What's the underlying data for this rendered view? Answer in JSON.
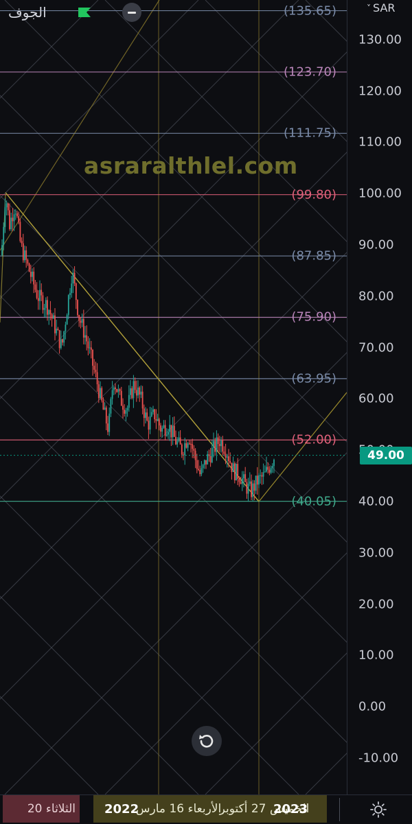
{
  "header": {
    "symbol": "الجوف",
    "flag_color": "#22c55e",
    "minimize_icon": "minus-icon"
  },
  "watermark": "asraralthlel.com",
  "price_axis": {
    "currency": "SAR",
    "ticks": [
      "130.00",
      "120.00",
      "110.00",
      "100.00",
      "90.00",
      "80.00",
      "70.00",
      "60.00",
      "50.00",
      "40.00",
      "30.00",
      "20.00",
      "10.00",
      "0.00",
      "-10.00"
    ],
    "last_price": "49.00",
    "last_price_color": "#089981"
  },
  "fib_levels": [
    {
      "label": "(135.65)",
      "color": "#7a8ba8"
    },
    {
      "label": "(123.70)",
      "color": "#b884b8"
    },
    {
      "label": "(111.75)",
      "color": "#7a8ba8"
    },
    {
      "label": "(99.80)",
      "color": "#e0607a"
    },
    {
      "label": "(87.85)",
      "color": "#7a8ba8"
    },
    {
      "label": "(75.90)",
      "color": "#b884b8"
    },
    {
      "label": "(63.95)",
      "color": "#7a8ba8"
    },
    {
      "label": "(52.00)",
      "color": "#e0607a"
    },
    {
      "label": "(40.05)",
      "color": "#3fa88a"
    }
  ],
  "time_axis": {
    "items": [
      {
        "text": "الثلاثاء 20",
        "style": "pink"
      },
      {
        "text": "2022",
        "style": "bold"
      },
      {
        "text": "الأربعاء 16 مارس",
        "style": "yellow"
      },
      {
        "text": "الخميس 27 أكتوبر",
        "style": "yellow"
      },
      {
        "text": "2023",
        "style": "bold"
      }
    ]
  },
  "controls": {
    "reset_icon": "rotate-ccw-icon",
    "settings_icon": "sun-icon"
  }
}
